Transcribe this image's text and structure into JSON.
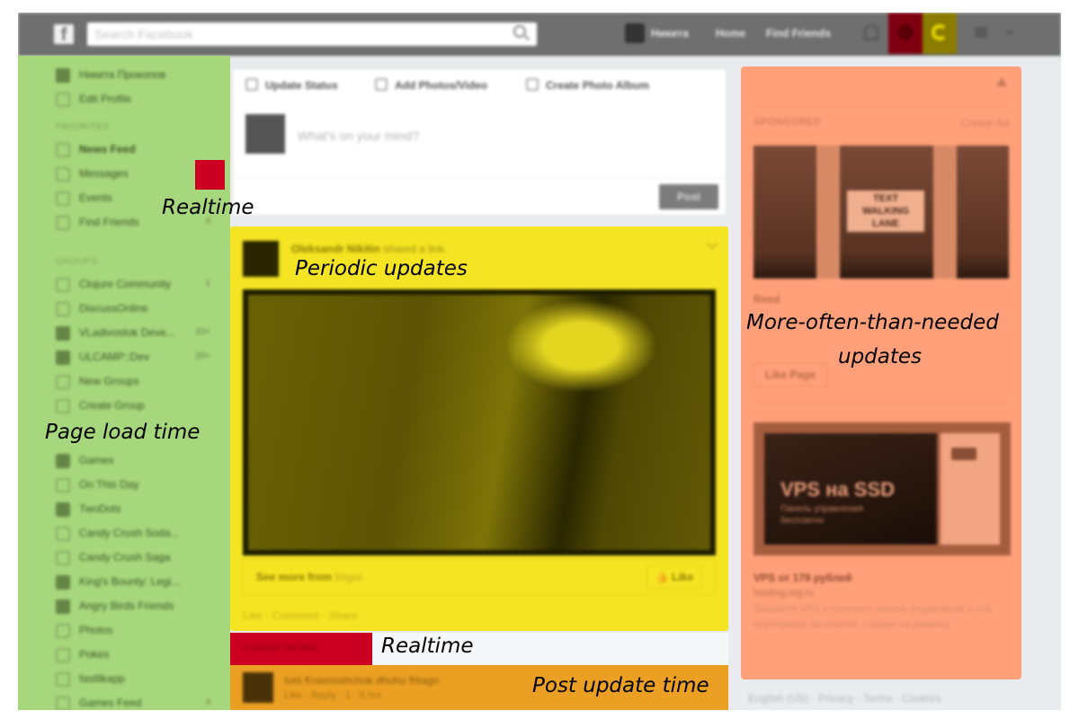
{
  "topbar": {
    "logo": "f",
    "search_placeholder": "Search Facebook",
    "profile_name": "Никита",
    "nav": [
      "Home",
      "Find Friends"
    ]
  },
  "sidebar": {
    "profile": "Никита Прокопов",
    "edit_profile": "Edit Profile",
    "favorites_heading": "FAVORITES",
    "favorites": [
      {
        "label": "News Feed",
        "count": "",
        "bold": true
      },
      {
        "label": "Messages",
        "count": ""
      },
      {
        "label": "Events",
        "count": ""
      },
      {
        "label": "Find Friends",
        "count": "4"
      }
    ],
    "groups_heading": "GROUPS",
    "groups": [
      {
        "label": "Clojure Community",
        "count": "1"
      },
      {
        "label": "DiscussOnline",
        "count": ""
      },
      {
        "label": "VLadivostok Deve...",
        "count": "20+"
      },
      {
        "label": "ULCAMP::Dev",
        "count": "20+"
      },
      {
        "label": "New Groups",
        "count": ""
      },
      {
        "label": "Create Group",
        "count": ""
      }
    ],
    "apps": [
      {
        "label": "Games",
        "count": ""
      },
      {
        "label": "On This Day",
        "count": ""
      },
      {
        "label": "TwoDots",
        "count": ""
      },
      {
        "label": "Candy Crush Soda...",
        "count": ""
      },
      {
        "label": "Candy Crush Saga",
        "count": ""
      },
      {
        "label": "King's Bounty: Legi...",
        "count": ""
      },
      {
        "label": "Angry Birds Friends",
        "count": ""
      },
      {
        "label": "Photos",
        "count": ""
      },
      {
        "label": "Pokes",
        "count": ""
      },
      {
        "label": "fastlikapp",
        "count": ""
      },
      {
        "label": "Games Feed",
        "count": "4"
      }
    ]
  },
  "composer": {
    "tabs": [
      "Update Status",
      "Add Photos/Video",
      "Create Photo Album"
    ],
    "placeholder": "What's on your mind?",
    "post_button": "Post"
  },
  "post": {
    "author": "Oleksandr Nikitin",
    "action": "shared a link.",
    "see_more": "See more from",
    "source": "Imgur.",
    "like_button": "Like",
    "actions": "Like · Comment · Share",
    "likes": "4 people like this."
  },
  "comment": {
    "text": "Iurii Krasnoshchok dhuhu fhtagn",
    "meta": "Like · Reply · 1 · 5 hrs"
  },
  "ads": {
    "sponsored": "SPONSORED",
    "create_ad": "Create Ad",
    "ad1_sign": [
      "TEXT",
      "WALKING",
      "LANE"
    ],
    "ad1_name": "Reed",
    "like_page": "Like Page",
    "ad2_big": "VPS на SSD",
    "ad2_small": "Панель управления бесплатно",
    "ad2_title": "VPS от 179 рублей",
    "ad2_url": "hosting.reg.ru",
    "ad2_desc": "Закажите VPS и получите панель управления и SSL сертификат бесплатно. Скидки на домены."
  },
  "footer": "English (US) · Privacy · Terms · Cookies",
  "annotations": {
    "realtime_messages": "Realtime",
    "periodic": "Periodic updates",
    "page_load": "Page load time",
    "realtime_likes": "Realtime",
    "post_update": "Post update time",
    "ads_line1": "More-often-than-needed",
    "ads_line2": "updates"
  },
  "colors": {
    "page_load": "#a7d77c",
    "realtime": "#cc0020",
    "periodic": "#f5e423",
    "post_update": "#eba023",
    "more_often": "#ffa07a"
  }
}
